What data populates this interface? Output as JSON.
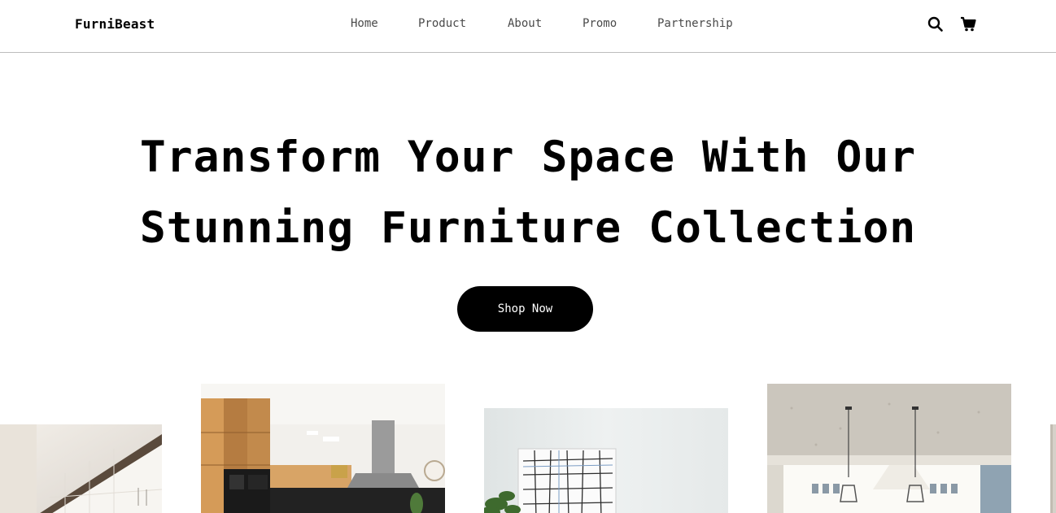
{
  "brand": "FurniBeast",
  "nav": {
    "items": [
      "Home",
      "Product",
      "About",
      "Promo",
      "Partnership"
    ]
  },
  "icons": {
    "search": "search-icon",
    "cart": "cart-icon"
  },
  "hero": {
    "title_line1": "Transform Your Space With Our",
    "title_line2": "Stunning Furniture Collection",
    "cta": "Shop Now"
  },
  "gallery": {
    "images": [
      "bathroom-interior",
      "modern-kitchen",
      "wall-art-living-room",
      "bright-kitchen-pendant-lights",
      "partial-interior"
    ]
  },
  "colors": {
    "primary": "#000000",
    "background": "#ffffff",
    "nav_text": "#4a4a4a",
    "divider": "#bdbdbd"
  }
}
